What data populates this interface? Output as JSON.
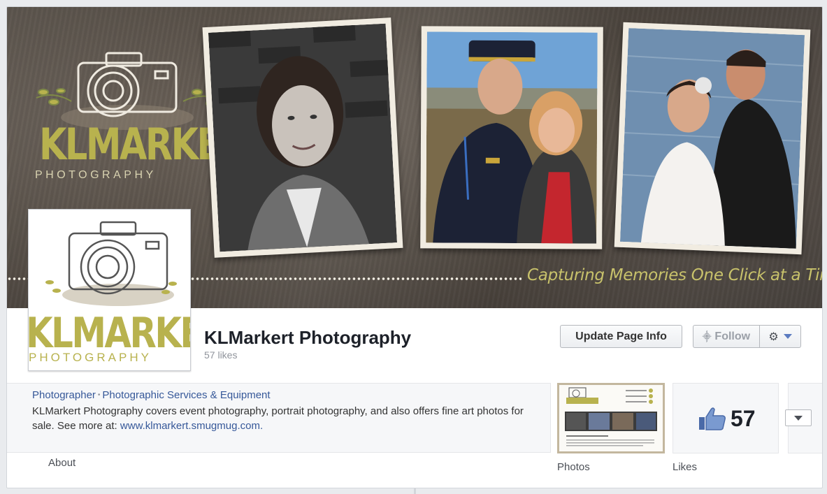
{
  "cover": {
    "brand": "KLMARKERT",
    "brand_sub": "PHOTOGRAPHY",
    "tagline": "Capturing Memories One Click at a Time."
  },
  "profile": {
    "brand": "KLMARKERT",
    "brand_sub": "PHOTOGRAPHY"
  },
  "page": {
    "name": "KLMarkert Photography",
    "likes_label": "57 likes"
  },
  "actions": {
    "update_label": "Update Page Info",
    "follow_label": "Follow",
    "settings_icon": "gear-icon"
  },
  "about": {
    "category_primary": "Photographer",
    "category_secondary": "Photographic Services & Equipment",
    "description": "KLMarkert Photography covers event photography, portrait photography, and also offers fine art photos for sale. See more at: ",
    "link": "www.klmarkert.smugmug.com."
  },
  "tabs": {
    "about": "About",
    "photos": "Photos",
    "likes": "Likes"
  },
  "likes_widget": {
    "count": "57",
    "icon": "thumbs-up-icon"
  },
  "colors": {
    "brand_olive": "#b8b24e",
    "link_blue": "#365899",
    "cover_bg": "#574f47"
  }
}
